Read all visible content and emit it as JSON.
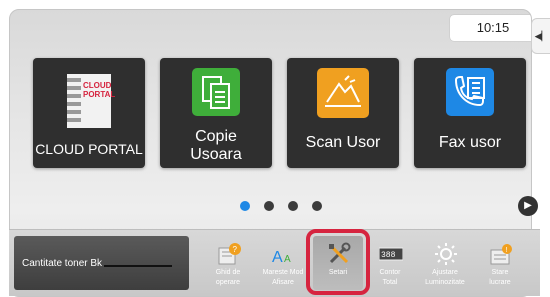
{
  "status": {
    "time": "10:15"
  },
  "tiles": [
    {
      "label": "CLOUD PORTAL",
      "icon": "cloud-portal-logo",
      "logo_text": [
        "CLOUD",
        "PORTAL"
      ]
    },
    {
      "label_lines": [
        "Copie",
        "Usoara"
      ],
      "icon": "copy-icon"
    },
    {
      "label": "Scan Usor",
      "icon": "scan-icon"
    },
    {
      "label": "Fax usor",
      "icon": "fax-icon"
    }
  ],
  "pager": {
    "count": 4,
    "active": 1
  },
  "bottom": {
    "toner_label": "Cantitate toner  Bk",
    "items": [
      {
        "lines": [
          "Ghid de",
          "operare"
        ],
        "icon": "guide-icon"
      },
      {
        "lines": [
          "Mareste Mod",
          "Afisare"
        ],
        "icon": "font-size-icon"
      },
      {
        "lines": [
          "Setari"
        ],
        "icon": "settings-tools-icon"
      },
      {
        "lines": [
          "Contor",
          "Total"
        ],
        "icon": "counter-icon"
      },
      {
        "lines": [
          "Ajustare",
          "Luminozitate"
        ],
        "icon": "brightness-icon"
      },
      {
        "lines": [
          "Stare",
          "lucrare"
        ],
        "icon": "job-status-icon"
      }
    ]
  },
  "colors": {
    "tile_bg": "#2f2f2f",
    "copy_green": "#3fae3a",
    "scan_orange": "#f0a020",
    "fax_blue": "#1e88e5",
    "highlight_red": "#d6243f",
    "dot_active": "#1e88e5"
  }
}
